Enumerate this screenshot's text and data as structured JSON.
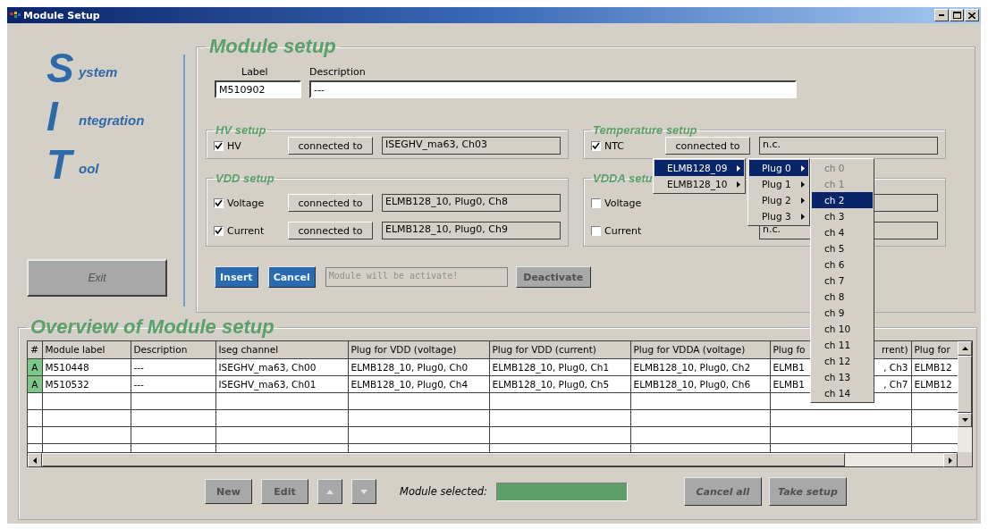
{
  "window": {
    "title": "Module Setup"
  },
  "logo": [
    {
      "initial": "S",
      "rest": "ystem"
    },
    {
      "initial": "I",
      "rest": "ntegration"
    },
    {
      "initial": "T",
      "rest": "ool"
    }
  ],
  "exit_button": {
    "label": "Exit",
    "disabled": true
  },
  "module_setup": {
    "title": "Module setup",
    "label": {
      "caption": "Label",
      "value": "M510902"
    },
    "description": {
      "caption": "Description",
      "value": "---"
    },
    "groups": [
      {
        "title": "HV setup",
        "rows": [
          {
            "label": "HV",
            "checked": true,
            "button": "connected to",
            "value": "ISEGHV_ma63, Ch03"
          }
        ]
      },
      {
        "title": "Temperature setup",
        "rows": [
          {
            "label": "NTC",
            "checked": true,
            "button": "connected to",
            "value": "n.c."
          }
        ]
      },
      {
        "title": "VDD setup",
        "rows": [
          {
            "label": "Voltage",
            "checked": true,
            "button": "connected to",
            "value": "ELMB128_10, Plug0, Ch8"
          },
          {
            "label": "Current",
            "checked": true,
            "button": "connected to",
            "value": "ELMB128_10, Plug0, Ch9"
          }
        ]
      },
      {
        "title": "VDDA setu",
        "rows": [
          {
            "label": "Voltage",
            "checked": false
          },
          {
            "label": "Current",
            "checked": false,
            "value": "n.c."
          }
        ]
      }
    ],
    "actions": [
      {
        "kind": "button",
        "label": "Insert",
        "disabled": false
      },
      {
        "kind": "button",
        "label": "Cancel",
        "disabled": false
      },
      {
        "kind": "status",
        "label": "Module will be activate!"
      },
      {
        "kind": "button",
        "label": "Deactivate",
        "disabled": true
      }
    ]
  },
  "context_menus": [
    {
      "items": [
        {
          "label": "ELMB128_09",
          "selected": true,
          "disabled": false,
          "submenu": true
        },
        {
          "label": "ELMB128_10",
          "selected": false,
          "disabled": false,
          "submenu": true
        }
      ]
    },
    {
      "items": [
        {
          "label": "Plug 0",
          "selected": true,
          "disabled": false,
          "submenu": true
        },
        {
          "label": "Plug 1",
          "selected": false,
          "disabled": false,
          "submenu": true
        },
        {
          "label": "Plug 2",
          "selected": false,
          "disabled": false,
          "submenu": true
        },
        {
          "label": "Plug 3",
          "selected": false,
          "disabled": false,
          "submenu": true
        }
      ]
    },
    {
      "items": [
        {
          "label": "ch 0",
          "selected": false,
          "disabled": true,
          "submenu": false
        },
        {
          "label": "ch 1",
          "selected": false,
          "disabled": true,
          "submenu": false
        },
        {
          "label": "ch 2",
          "selected": true,
          "disabled": false,
          "submenu": false
        },
        {
          "label": "ch 3",
          "selected": false,
          "disabled": false,
          "submenu": false
        },
        {
          "label": "ch 4",
          "selected": false,
          "disabled": false,
          "submenu": false
        },
        {
          "label": "ch 5",
          "selected": false,
          "disabled": false,
          "submenu": false
        },
        {
          "label": "ch 6",
          "selected": false,
          "disabled": false,
          "submenu": false
        },
        {
          "label": "ch 7",
          "selected": false,
          "disabled": false,
          "submenu": false
        },
        {
          "label": "ch 8",
          "selected": false,
          "disabled": false,
          "submenu": false
        },
        {
          "label": "ch 9",
          "selected": false,
          "disabled": false,
          "submenu": false
        },
        {
          "label": "ch 10",
          "selected": false,
          "disabled": false,
          "submenu": false
        },
        {
          "label": "ch 11",
          "selected": false,
          "disabled": false,
          "submenu": false
        },
        {
          "label": "ch 12",
          "selected": false,
          "disabled": false,
          "submenu": false
        },
        {
          "label": "ch 13",
          "selected": false,
          "disabled": false,
          "submenu": false
        },
        {
          "label": "ch 14",
          "selected": false,
          "disabled": false,
          "submenu": false
        }
      ]
    }
  ],
  "overview": {
    "title": "Overview of Module setup",
    "table": {
      "columns": [
        {
          "label": "#"
        },
        {
          "label": "Module label"
        },
        {
          "label": "Description"
        },
        {
          "label": "Iseg channel"
        },
        {
          "label": "Plug for VDD (voltage)"
        },
        {
          "label": "Plug for VDD (current)"
        },
        {
          "label": "Plug for VDDA (voltage)"
        },
        {
          "label": "Plug fo",
          "label_end": "rrent)"
        },
        {
          "label": "Plug for"
        }
      ],
      "rows": [
        {
          "cells": [
            "A",
            "M510448",
            "---",
            "ISEGHV_ma63, Ch00",
            "ELMB128_10, Plug0, Ch0",
            "ELMB128_10, Plug0, Ch1",
            "ELMB128_10, Plug0, Ch2",
            {
              "text": "ELMB1",
              "text_end": ", Ch3"
            },
            "ELMB12"
          ]
        },
        {
          "cells": [
            "A",
            "M510532",
            "---",
            "ISEGHV_ma63, Ch01",
            "ELMB128_10, Plug0, Ch4",
            "ELMB128_10, Plug0, Ch5",
            "ELMB128_10, Plug0, Ch6",
            {
              "text": "ELMB1",
              "text_end": ", Ch7"
            },
            "ELMB12"
          ]
        }
      ]
    },
    "buttons": [
      {
        "kind": "text",
        "label": "New",
        "disabled": true
      },
      {
        "kind": "text",
        "label": "Edit",
        "disabled": true
      },
      {
        "kind": "up",
        "disabled": true
      },
      {
        "kind": "down",
        "disabled": true
      }
    ],
    "selected_label": "Module selected:",
    "footer_buttons": [
      {
        "label": "Cancel all",
        "disabled": true
      },
      {
        "label": "Take setup",
        "disabled": true
      }
    ]
  }
}
